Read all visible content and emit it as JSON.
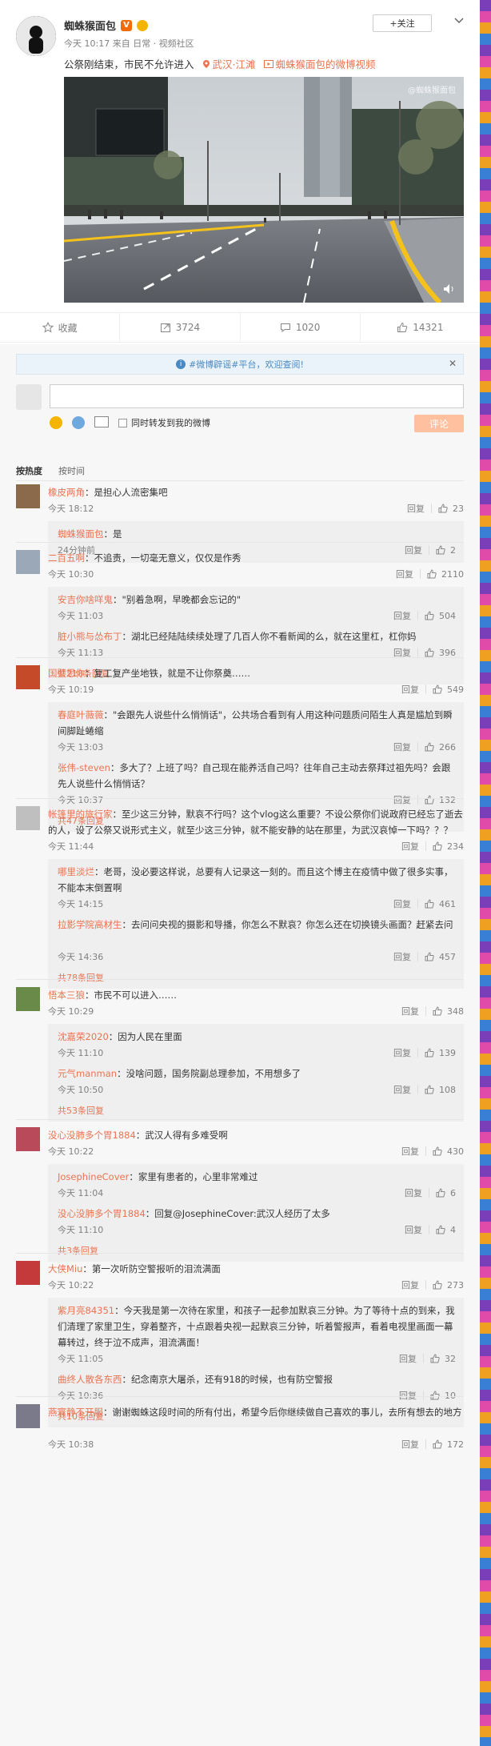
{
  "post": {
    "author": "蜘蛛猴面包",
    "follow_label": "+关注",
    "time": "今天 10:17 来自 日常 · 视频社区",
    "text": "公祭刚结束，市民不允许进入",
    "location": "武汉·江滩",
    "video_link": "蜘蛛猴面包的微博视频",
    "watermark": "@蜘蛛猴面包"
  },
  "actions": {
    "favorite": "收藏",
    "forward": "3724",
    "comment": "1020",
    "like": "14321"
  },
  "comment_box": {
    "notice": "#微博辟谣#平台，欢迎查阅!",
    "forward_label": "同时转发到我的微博",
    "post_label": "评论"
  },
  "sort": {
    "hot": "按热度",
    "time": "按时间"
  },
  "labels": {
    "reply": "回复"
  },
  "comments": [
    {
      "user": "橡皮两角",
      "text": "：是担心人流密集吧",
      "time": "今天 18:12",
      "likes": "23",
      "replies": [
        {
          "user": "蜘蛛猴面包",
          "text": "：是",
          "time": "24分钟前",
          "likes": "2"
        }
      ],
      "more": ""
    },
    {
      "user": "二百五啊",
      "text": "：不追责，一切毫无意义，仅仅是作秀",
      "time": "今天 10:30",
      "likes": "2110",
      "replies": [
        {
          "user": "安吉你啥咩鬼",
          "text": "：\"别着急啊，早晚都会忘记的\"",
          "time": "今天 11:03",
          "likes": "504"
        },
        {
          "user": "脏小熊与怂布丁",
          "text": "：湖北已经陆陆续续处理了几百人你不看新闻的么，就在这里杠，杠你妈",
          "time": "今天 11:13",
          "likes": "396"
        }
      ],
      "more": "共218条回复"
    },
    {
      "user": "国壁思你",
      "text": "：复工复产坐地铁，就是不让你祭奠……",
      "time": "今天 10:19",
      "likes": "549",
      "replies": [
        {
          "user": "春庭叶薇薇",
          "text": "：\"会跟先人说些什么悄悄话\"，公共场合看到有人用这种问题质问陌生人真是尴尬到瞬间脚趾蜷缩",
          "time": "今天 13:03",
          "likes": "266"
        },
        {
          "user": "张伟-steven",
          "text": "：多大了？上班了吗？自己现在能养活自己吗？往年自己主动去祭拜过祖先吗？会跟先人说些什么悄悄话？",
          "time": "今天 10:37",
          "likes": "132"
        }
      ],
      "more": "共47条回复"
    },
    {
      "user": "帐篷里的旅行家",
      "text": "：至少这三分钟，默哀不行吗？这个vlog这么重要？不设公祭你们说政府已经忘了逝去的人，设了公祭又说形式主义，就至少这三分钟，就不能安静的站在那里，为武汉哀悼一下吗？？？",
      "time": "今天 11:44",
      "likes": "234",
      "replies": [
        {
          "user": "哪里淡烂",
          "text": "：老哥，没必要这样说，总要有人记录这一刻的。而且这个博主在疫情中做了很多实事，不能本末倒置啊",
          "time": "今天 14:15",
          "likes": "461"
        },
        {
          "user": "拉影学院高材生",
          "text": "：去问问央视的摄影和导播，你怎么不默哀？你怎么还在切换镜头画面？赶紧去问",
          "time": "今天 14:36",
          "likes": "457"
        }
      ],
      "more": "共78条回复"
    },
    {
      "user": "悟本三狼",
      "text": "：市民不可以进入……",
      "time": "今天 10:29",
      "likes": "348",
      "replies": [
        {
          "user": "沈嘉荣2020",
          "text": "：因为人民在里面",
          "time": "今天 11:10",
          "likes": "139"
        },
        {
          "user": "元气manman",
          "text": "：没啥问题，国务院副总理参加，不用想多了",
          "time": "今天 10:50",
          "likes": "108"
        }
      ],
      "more": "共53条回复"
    },
    {
      "user": "没心没肺多个胃1884",
      "text": "：武汉人得有多难受啊",
      "time": "今天 10:22",
      "likes": "430",
      "replies": [
        {
          "user": "JosephineCover",
          "text": "：家里有患者的，心里非常难过",
          "time": "今天 11:04",
          "likes": "6"
        },
        {
          "user": "没心没肺多个胃1884",
          "text": "：回复@JosephineCover:武汉人经历了太多",
          "time": "今天 11:10",
          "likes": "4"
        }
      ],
      "more": "共3条回复"
    },
    {
      "user": "大侠Miu",
      "text": "：第一次听防空警报听的泪流满面",
      "time": "今天 10:22",
      "likes": "273",
      "replies": [
        {
          "user": "紫月亮84351",
          "text": "：今天我是第一次待在家里，和孩子一起参加默哀三分钟。为了等待十点的到来，我们清理了家里卫生，穿着整齐，十点跟着央视一起默哀三分钟，听着警报声，看着电视里画面一幕幕转过，终于泣不成声，泪流满面！",
          "time": "今天 11:05",
          "likes": "32"
        },
        {
          "user": "曲终人散各东西",
          "text": "：纪念南京大屠杀，还有918的时候，也有防空警报",
          "time": "今天 10:36",
          "likes": "10"
        }
      ],
      "more": "共10条回复"
    },
    {
      "user": "燕寰静不开服",
      "text": "：谢谢蜘蛛这段时间的所有付出，希望今后你继续做自己喜欢的事儿，去所有想去的地方",
      "time": "今天 10:38",
      "likes": "172",
      "replies": [],
      "more": ""
    }
  ],
  "colors": {
    "accent": "#eb7350",
    "orange": "#ff8200",
    "stripe": "#7a3fb8"
  }
}
